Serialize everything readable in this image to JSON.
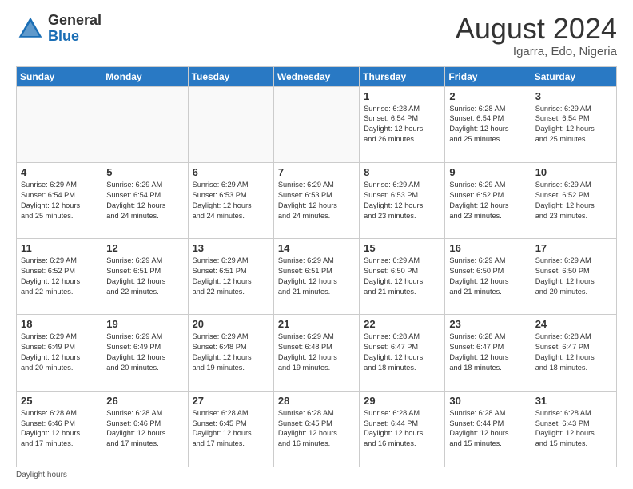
{
  "header": {
    "logo_general": "General",
    "logo_blue": "Blue",
    "month_year": "August 2024",
    "location": "Igarra, Edo, Nigeria"
  },
  "days_of_week": [
    "Sunday",
    "Monday",
    "Tuesday",
    "Wednesday",
    "Thursday",
    "Friday",
    "Saturday"
  ],
  "weeks": [
    [
      {
        "day": "",
        "info": ""
      },
      {
        "day": "",
        "info": ""
      },
      {
        "day": "",
        "info": ""
      },
      {
        "day": "",
        "info": ""
      },
      {
        "day": "1",
        "info": "Sunrise: 6:28 AM\nSunset: 6:54 PM\nDaylight: 12 hours\nand 26 minutes."
      },
      {
        "day": "2",
        "info": "Sunrise: 6:28 AM\nSunset: 6:54 PM\nDaylight: 12 hours\nand 25 minutes."
      },
      {
        "day": "3",
        "info": "Sunrise: 6:29 AM\nSunset: 6:54 PM\nDaylight: 12 hours\nand 25 minutes."
      }
    ],
    [
      {
        "day": "4",
        "info": "Sunrise: 6:29 AM\nSunset: 6:54 PM\nDaylight: 12 hours\nand 25 minutes."
      },
      {
        "day": "5",
        "info": "Sunrise: 6:29 AM\nSunset: 6:54 PM\nDaylight: 12 hours\nand 24 minutes."
      },
      {
        "day": "6",
        "info": "Sunrise: 6:29 AM\nSunset: 6:53 PM\nDaylight: 12 hours\nand 24 minutes."
      },
      {
        "day": "7",
        "info": "Sunrise: 6:29 AM\nSunset: 6:53 PM\nDaylight: 12 hours\nand 24 minutes."
      },
      {
        "day": "8",
        "info": "Sunrise: 6:29 AM\nSunset: 6:53 PM\nDaylight: 12 hours\nand 23 minutes."
      },
      {
        "day": "9",
        "info": "Sunrise: 6:29 AM\nSunset: 6:52 PM\nDaylight: 12 hours\nand 23 minutes."
      },
      {
        "day": "10",
        "info": "Sunrise: 6:29 AM\nSunset: 6:52 PM\nDaylight: 12 hours\nand 23 minutes."
      }
    ],
    [
      {
        "day": "11",
        "info": "Sunrise: 6:29 AM\nSunset: 6:52 PM\nDaylight: 12 hours\nand 22 minutes."
      },
      {
        "day": "12",
        "info": "Sunrise: 6:29 AM\nSunset: 6:51 PM\nDaylight: 12 hours\nand 22 minutes."
      },
      {
        "day": "13",
        "info": "Sunrise: 6:29 AM\nSunset: 6:51 PM\nDaylight: 12 hours\nand 22 minutes."
      },
      {
        "day": "14",
        "info": "Sunrise: 6:29 AM\nSunset: 6:51 PM\nDaylight: 12 hours\nand 21 minutes."
      },
      {
        "day": "15",
        "info": "Sunrise: 6:29 AM\nSunset: 6:50 PM\nDaylight: 12 hours\nand 21 minutes."
      },
      {
        "day": "16",
        "info": "Sunrise: 6:29 AM\nSunset: 6:50 PM\nDaylight: 12 hours\nand 21 minutes."
      },
      {
        "day": "17",
        "info": "Sunrise: 6:29 AM\nSunset: 6:50 PM\nDaylight: 12 hours\nand 20 minutes."
      }
    ],
    [
      {
        "day": "18",
        "info": "Sunrise: 6:29 AM\nSunset: 6:49 PM\nDaylight: 12 hours\nand 20 minutes."
      },
      {
        "day": "19",
        "info": "Sunrise: 6:29 AM\nSunset: 6:49 PM\nDaylight: 12 hours\nand 20 minutes."
      },
      {
        "day": "20",
        "info": "Sunrise: 6:29 AM\nSunset: 6:48 PM\nDaylight: 12 hours\nand 19 minutes."
      },
      {
        "day": "21",
        "info": "Sunrise: 6:29 AM\nSunset: 6:48 PM\nDaylight: 12 hours\nand 19 minutes."
      },
      {
        "day": "22",
        "info": "Sunrise: 6:28 AM\nSunset: 6:47 PM\nDaylight: 12 hours\nand 18 minutes."
      },
      {
        "day": "23",
        "info": "Sunrise: 6:28 AM\nSunset: 6:47 PM\nDaylight: 12 hours\nand 18 minutes."
      },
      {
        "day": "24",
        "info": "Sunrise: 6:28 AM\nSunset: 6:47 PM\nDaylight: 12 hours\nand 18 minutes."
      }
    ],
    [
      {
        "day": "25",
        "info": "Sunrise: 6:28 AM\nSunset: 6:46 PM\nDaylight: 12 hours\nand 17 minutes."
      },
      {
        "day": "26",
        "info": "Sunrise: 6:28 AM\nSunset: 6:46 PM\nDaylight: 12 hours\nand 17 minutes."
      },
      {
        "day": "27",
        "info": "Sunrise: 6:28 AM\nSunset: 6:45 PM\nDaylight: 12 hours\nand 17 minutes."
      },
      {
        "day": "28",
        "info": "Sunrise: 6:28 AM\nSunset: 6:45 PM\nDaylight: 12 hours\nand 16 minutes."
      },
      {
        "day": "29",
        "info": "Sunrise: 6:28 AM\nSunset: 6:44 PM\nDaylight: 12 hours\nand 16 minutes."
      },
      {
        "day": "30",
        "info": "Sunrise: 6:28 AM\nSunset: 6:44 PM\nDaylight: 12 hours\nand 15 minutes."
      },
      {
        "day": "31",
        "info": "Sunrise: 6:28 AM\nSunset: 6:43 PM\nDaylight: 12 hours\nand 15 minutes."
      }
    ]
  ],
  "footer": {
    "note": "Daylight hours"
  }
}
